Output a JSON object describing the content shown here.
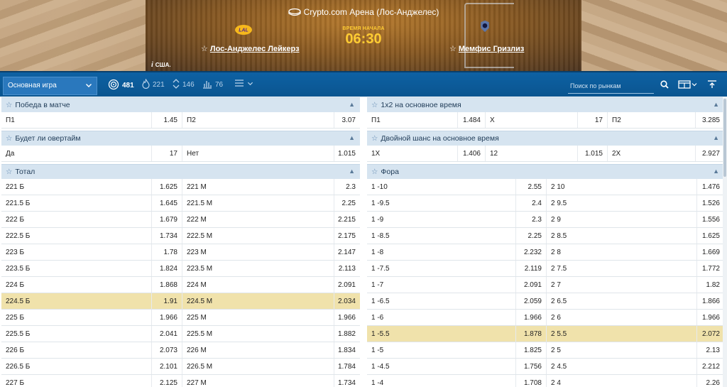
{
  "event": {
    "venue": "Crypto.com Арена (Лос-Анджелес)",
    "time_label": "ВРЕМЯ НАЧАЛА",
    "time": "06:30",
    "home_team": "Лос-Анджелес Лейкерз",
    "away_team": "Мемфис Гризлиз",
    "country": "США."
  },
  "toolbar": {
    "main_select": "Основная игра",
    "tabs": [
      {
        "icon": "target-icon",
        "count": "481"
      },
      {
        "icon": "fire-icon",
        "count": "221"
      },
      {
        "icon": "updown-arrows-icon",
        "count": "146"
      },
      {
        "icon": "stats-icon",
        "count": "76"
      }
    ],
    "search_placeholder": "Поиск по рынкам"
  },
  "colors": {
    "accent": "#0e61a3",
    "header_bg": "#d6e4f0",
    "highlight": "#f0e2ab",
    "time": "#ffcc33"
  },
  "markets": {
    "win": {
      "title": "Победа в матче",
      "rows": [
        {
          "a": "П1",
          "ao": "1.45",
          "b": "П2",
          "bo": "3.07"
        }
      ]
    },
    "overtime": {
      "title": "Будет ли овертайм",
      "rows": [
        {
          "a": "Да",
          "ao": "17",
          "b": "Нет",
          "bo": "1.015"
        }
      ]
    },
    "total": {
      "title": "Тотал",
      "rows": [
        {
          "a": "221 Б",
          "ao": "1.625",
          "b": "221 М",
          "bo": "2.3"
        },
        {
          "a": "221.5 Б",
          "ao": "1.645",
          "b": "221.5 М",
          "bo": "2.25"
        },
        {
          "a": "222 Б",
          "ao": "1.679",
          "b": "222 М",
          "bo": "2.215"
        },
        {
          "a": "222.5 Б",
          "ao": "1.734",
          "b": "222.5 М",
          "bo": "2.175"
        },
        {
          "a": "223 Б",
          "ao": "1.78",
          "b": "223 М",
          "bo": "2.147"
        },
        {
          "a": "223.5 Б",
          "ao": "1.824",
          "b": "223.5 М",
          "bo": "2.113"
        },
        {
          "a": "224 Б",
          "ao": "1.868",
          "b": "224 М",
          "bo": "2.091"
        },
        {
          "a": "224.5 Б",
          "ao": "1.91",
          "b": "224.5 М",
          "bo": "2.034",
          "hl": true
        },
        {
          "a": "225 Б",
          "ao": "1.966",
          "b": "225 М",
          "bo": "1.966"
        },
        {
          "a": "225.5 Б",
          "ao": "2.041",
          "b": "225.5 М",
          "bo": "1.882"
        },
        {
          "a": "226 Б",
          "ao": "2.073",
          "b": "226 М",
          "bo": "1.834"
        },
        {
          "a": "226.5 Б",
          "ao": "2.101",
          "b": "226.5 М",
          "bo": "1.784"
        },
        {
          "a": "227 Б",
          "ao": "2.125",
          "b": "227 М",
          "bo": "1.734"
        }
      ]
    },
    "onextwo": {
      "title": "1х2 на основное время",
      "rows": [
        {
          "a": "П1",
          "ao": "1.484",
          "b": "X",
          "bo": "17",
          "c": "П2",
          "co": "3.285"
        }
      ]
    },
    "double": {
      "title": "Двойной шанс на основное время",
      "rows": [
        {
          "a": "1X",
          "ao": "1.406",
          "b": "12",
          "bo": "1.015",
          "c": "2X",
          "co": "2.927"
        }
      ]
    },
    "handicap": {
      "title": "Фора",
      "rows": [
        {
          "a": "1 -10",
          "ao": "2.55",
          "b": "2 10",
          "bo": "1.476"
        },
        {
          "a": "1 -9.5",
          "ao": "2.4",
          "b": "2 9.5",
          "bo": "1.526"
        },
        {
          "a": "1 -9",
          "ao": "2.3",
          "b": "2 9",
          "bo": "1.556"
        },
        {
          "a": "1 -8.5",
          "ao": "2.25",
          "b": "2 8.5",
          "bo": "1.625"
        },
        {
          "a": "1 -8",
          "ao": "2.232",
          "b": "2 8",
          "bo": "1.669"
        },
        {
          "a": "1 -7.5",
          "ao": "2.119",
          "b": "2 7.5",
          "bo": "1.772"
        },
        {
          "a": "1 -7",
          "ao": "2.091",
          "b": "2 7",
          "bo": "1.82"
        },
        {
          "a": "1 -6.5",
          "ao": "2.059",
          "b": "2 6.5",
          "bo": "1.866"
        },
        {
          "a": "1 -6",
          "ao": "1.966",
          "b": "2 6",
          "bo": "1.966"
        },
        {
          "a": "1 -5.5",
          "ao": "1.878",
          "b": "2 5.5",
          "bo": "2.072",
          "hl": true
        },
        {
          "a": "1 -5",
          "ao": "1.825",
          "b": "2 5",
          "bo": "2.13"
        },
        {
          "a": "1 -4.5",
          "ao": "1.756",
          "b": "2 4.5",
          "bo": "2.212"
        },
        {
          "a": "1 -4",
          "ao": "1.708",
          "b": "2 4",
          "bo": "2.26"
        }
      ]
    }
  }
}
